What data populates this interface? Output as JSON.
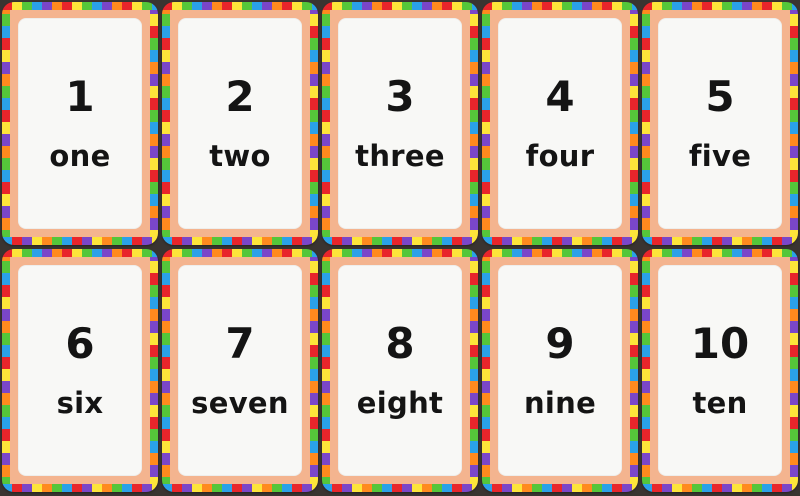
{
  "cards": [
    {
      "numeral": "1",
      "word": "one"
    },
    {
      "numeral": "2",
      "word": "two"
    },
    {
      "numeral": "3",
      "word": "three"
    },
    {
      "numeral": "4",
      "word": "four"
    },
    {
      "numeral": "5",
      "word": "five"
    },
    {
      "numeral": "6",
      "word": "six"
    },
    {
      "numeral": "7",
      "word": "seven"
    },
    {
      "numeral": "8",
      "word": "eight"
    },
    {
      "numeral": "9",
      "word": "nine"
    },
    {
      "numeral": "10",
      "word": "ten"
    }
  ],
  "colors": {
    "background": "#3a3431",
    "card_border": "#f4b48f",
    "card_face": "#f8f8f6",
    "text": "#141414",
    "accents": [
      "#e8252b",
      "#fde53a",
      "#55c63a",
      "#2aa1e8",
      "#7a46c9",
      "#ff8a1e"
    ]
  }
}
